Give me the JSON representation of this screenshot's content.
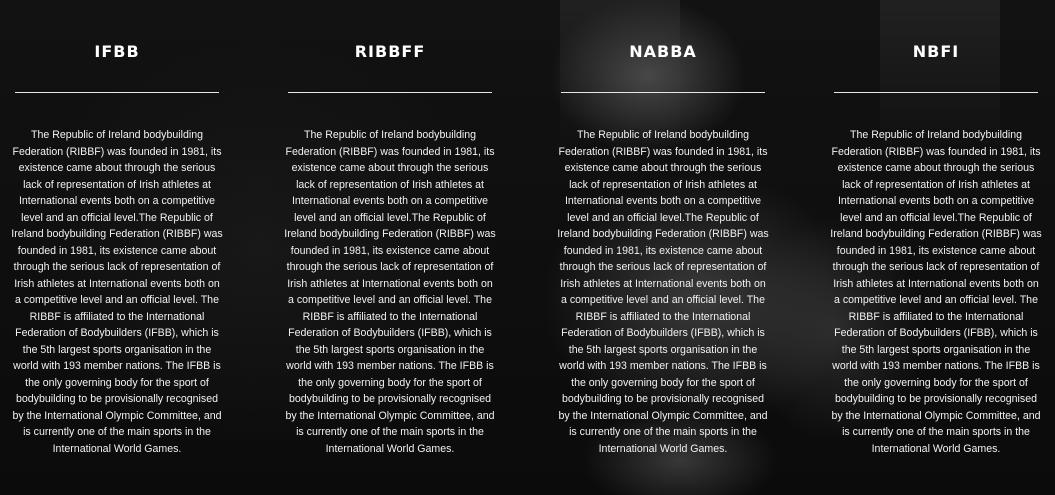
{
  "columns": [
    {
      "title": "IFBB",
      "text": "The Republic of Ireland bodybuilding Federation (RIBBF) was founded in 1981, its existence came about through the serious lack of representation of Irish athletes at International events both on a competitive level and an official level.The Republic of Ireland bodybuilding Federation (RIBBF) was founded in 1981, its existence came about through the serious lack of representation of Irish athletes at International events both on a competitive level and an official level. The RIBBF is affiliated to the International Federation of Bodybuilders (IFBB), which is the 5th largest sports organisation in the world with 193 member nations. The IFBB is the only governing body for the sport of bodybuilding to be provisionally recognised by the International Olympic Committee, and is currently one of the main sports in the International World Games."
    },
    {
      "title": "RIBBFF",
      "text": "The Republic of Ireland bodybuilding Federation (RIBBF) was founded in 1981, its existence came about through the serious lack of representation of Irish athletes at International events both on a competitive level and an official level.The Republic of Ireland bodybuilding Federation (RIBBF) was founded in 1981, its existence came about through the serious lack of representation of Irish athletes at International events both on a competitive level and an official level. The RIBBF is affiliated to the International Federation of Bodybuilders (IFBB), which is the 5th largest sports organisation in the world with 193 member nations. The IFBB is the only governing body for the sport of bodybuilding to be provisionally recognised by the International Olympic Committee, and is currently one of the main sports in the International World Games."
    },
    {
      "title": "NABBA",
      "text": "The Republic of Ireland bodybuilding Federation (RIBBF) was founded in 1981, its existence came about through the serious lack of representation of Irish athletes at International events both on a competitive level and an official level.The Republic of Ireland bodybuilding Federation (RIBBF) was founded in 1981, its existence came about through the serious lack of representation of Irish athletes at International events both on a competitive level and an official level. The RIBBF is affiliated to the International Federation of Bodybuilders (IFBB), which is the 5th largest sports organisation in the world with 193 member nations. The IFBB is the only governing body for the sport of bodybuilding to be provisionally recognised by the International Olympic Committee, and is currently one of the main sports in the International World Games."
    },
    {
      "title": "NBFI",
      "text": "The Republic of Ireland bodybuilding Federation (RIBBF) was founded in 1981, its existence came about through the serious lack of representation of Irish athletes at International events both on a competitive level and an official level.The Republic of Ireland bodybuilding Federation (RIBBF) was founded in 1981, its existence came about through the serious lack of representation of Irish athletes at International events both on a competitive level and an official level. The RIBBF is affiliated to the International Federation of Bodybuilders (IFBB), which is the 5th largest sports organisation in the world with 193 member nations. The IFBB is the only governing body for the sport of bodybuilding to be provisionally recognised by the International Olympic Committee, and is currently one of the main sports in the International World Games."
    }
  ],
  "colors": {
    "background": "#0a0a0a",
    "text": "#ffffff",
    "rule": "#e6e6e6"
  }
}
